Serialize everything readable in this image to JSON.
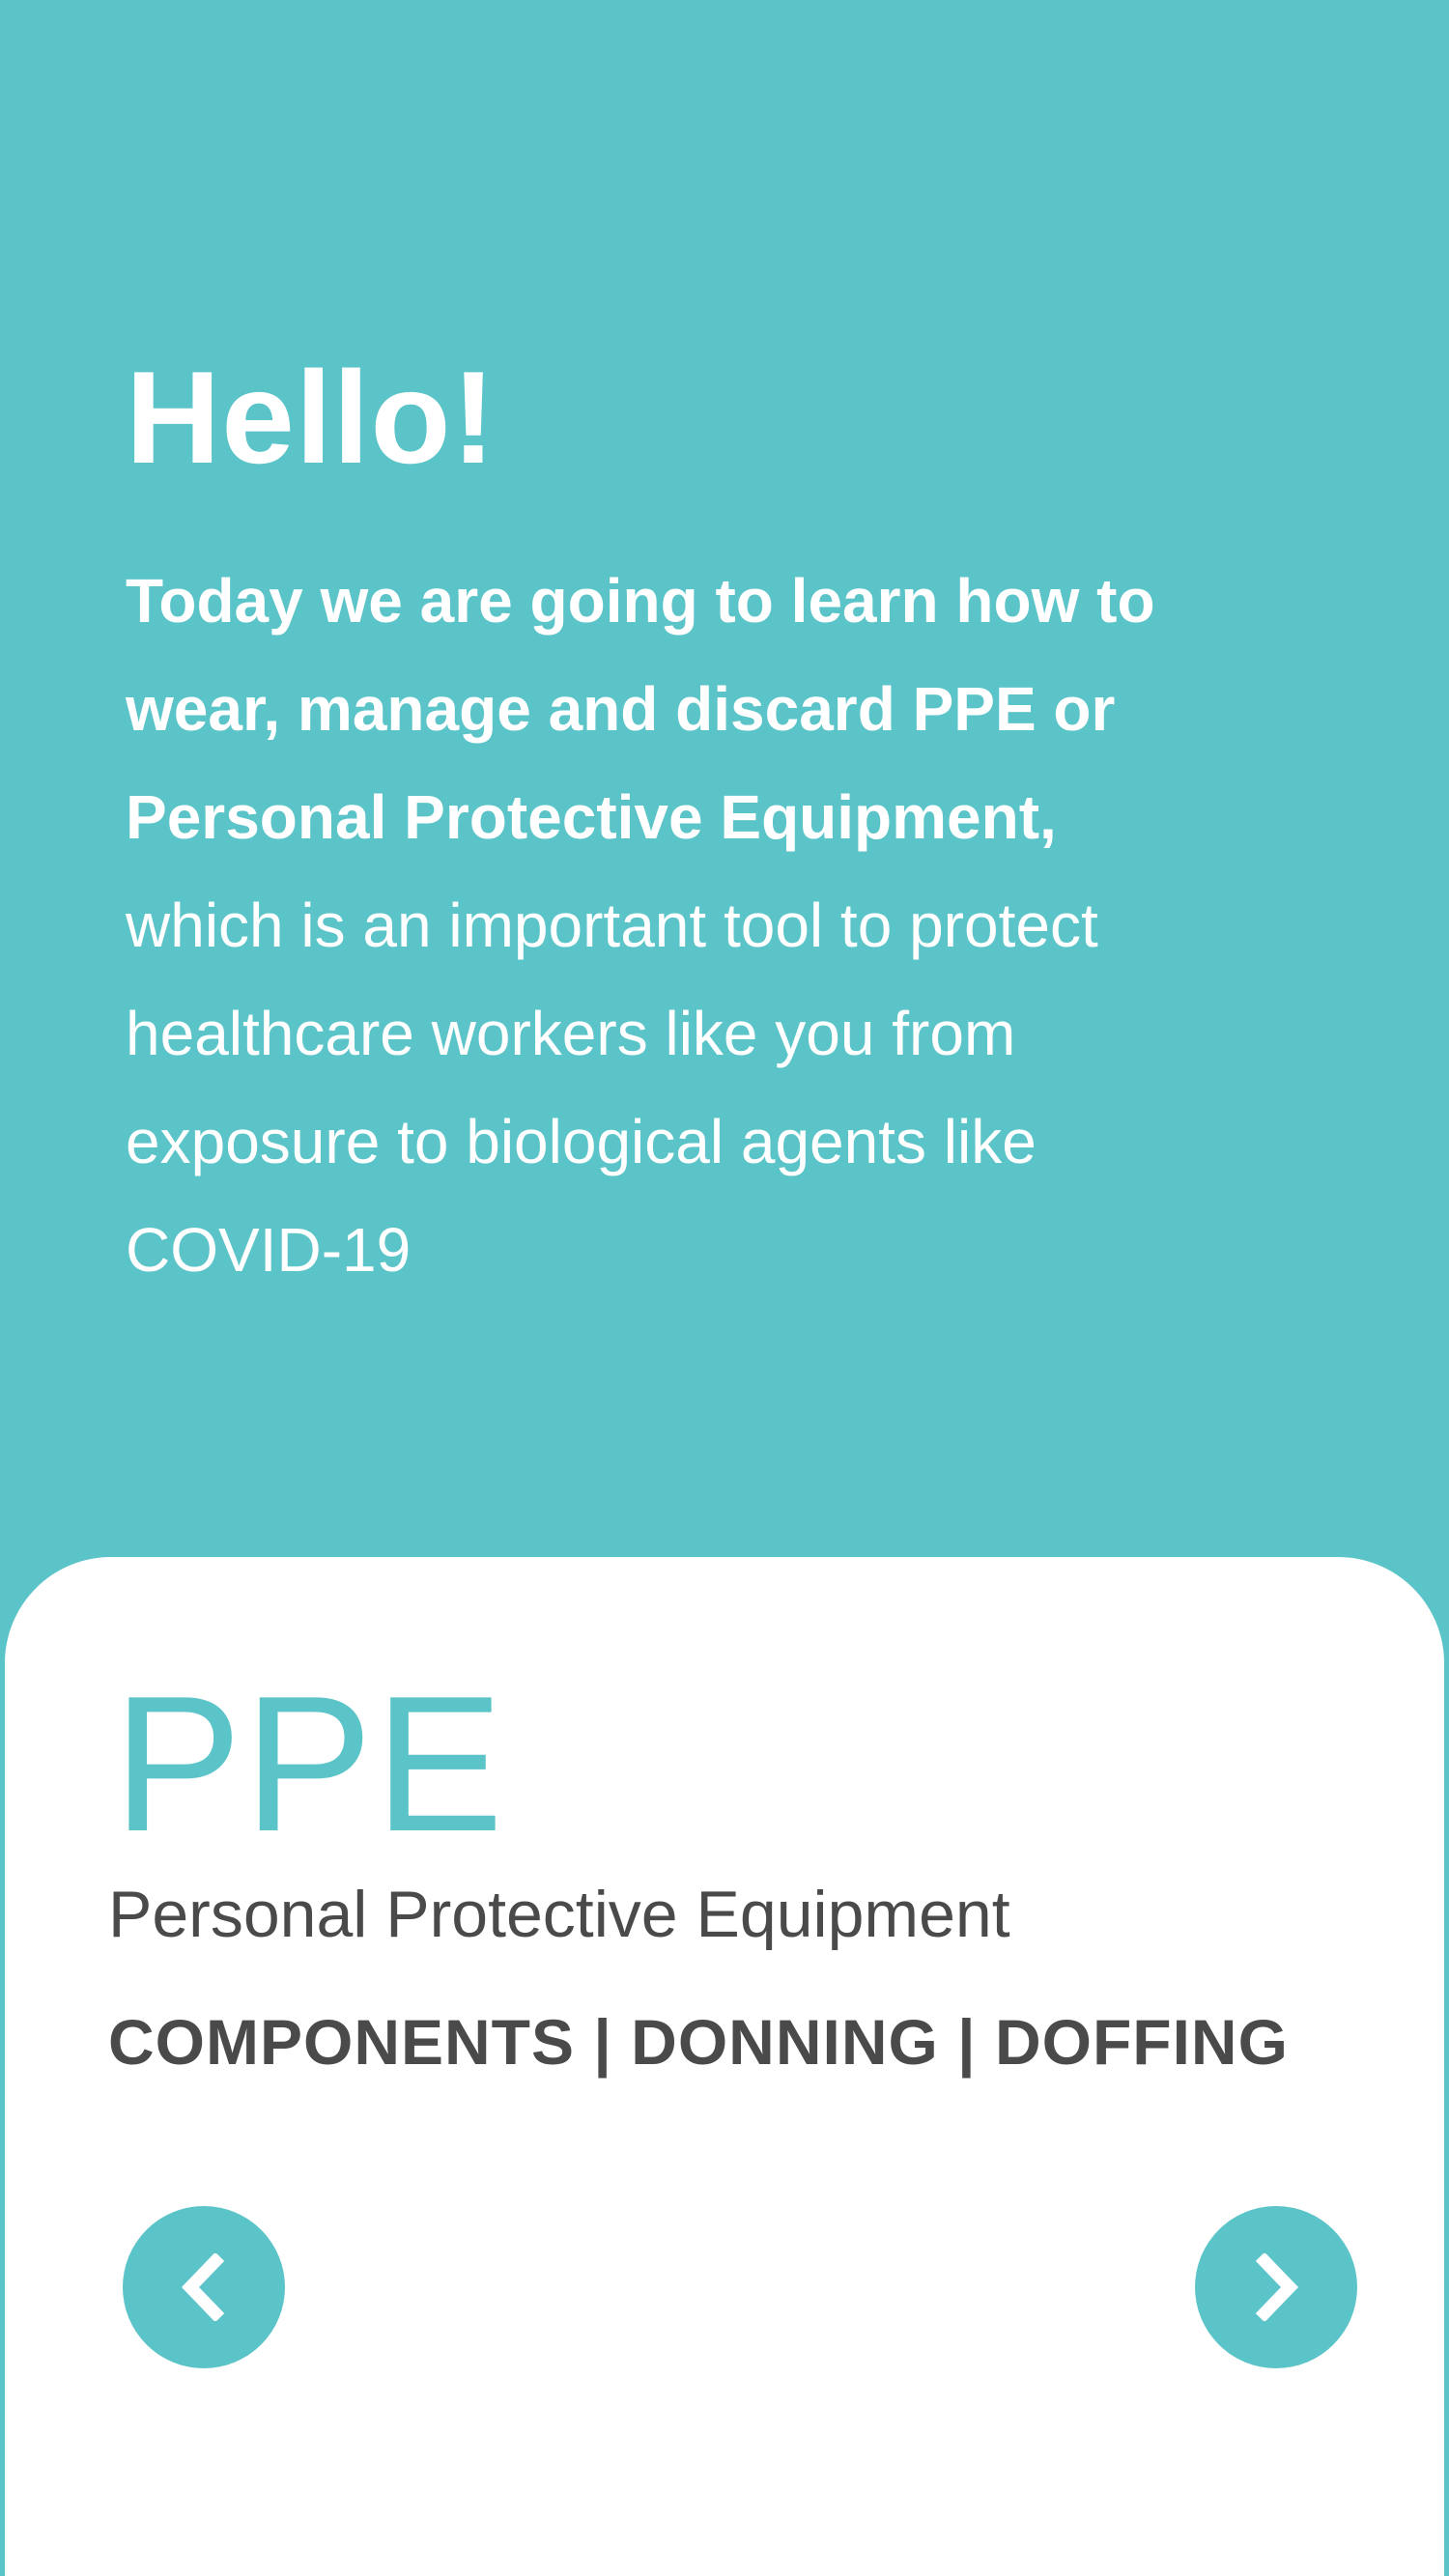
{
  "hero": {
    "greeting": "Hello!",
    "intro_bold": [
      "Today we are going to learn how to",
      "wear, manage and discard PPE or",
      "Personal Protective Equipment,"
    ],
    "intro_normal": [
      "which is an important tool to protect",
      "healthcare workers like you from",
      "exposure to biological agents like",
      "COVID-19"
    ]
  },
  "card": {
    "title": "PPE",
    "subtitle": "Personal Protective Equipment",
    "sections": "COMPONENTS | DONNING | DOFFING",
    "prev_icon": "chevron-left-icon",
    "next_icon": "chevron-right-icon"
  },
  "colors": {
    "accent": "#5bc4c8",
    "card_background": "#ffffff",
    "text_dark": "#4a4a4a",
    "text_light": "#ffffff"
  }
}
